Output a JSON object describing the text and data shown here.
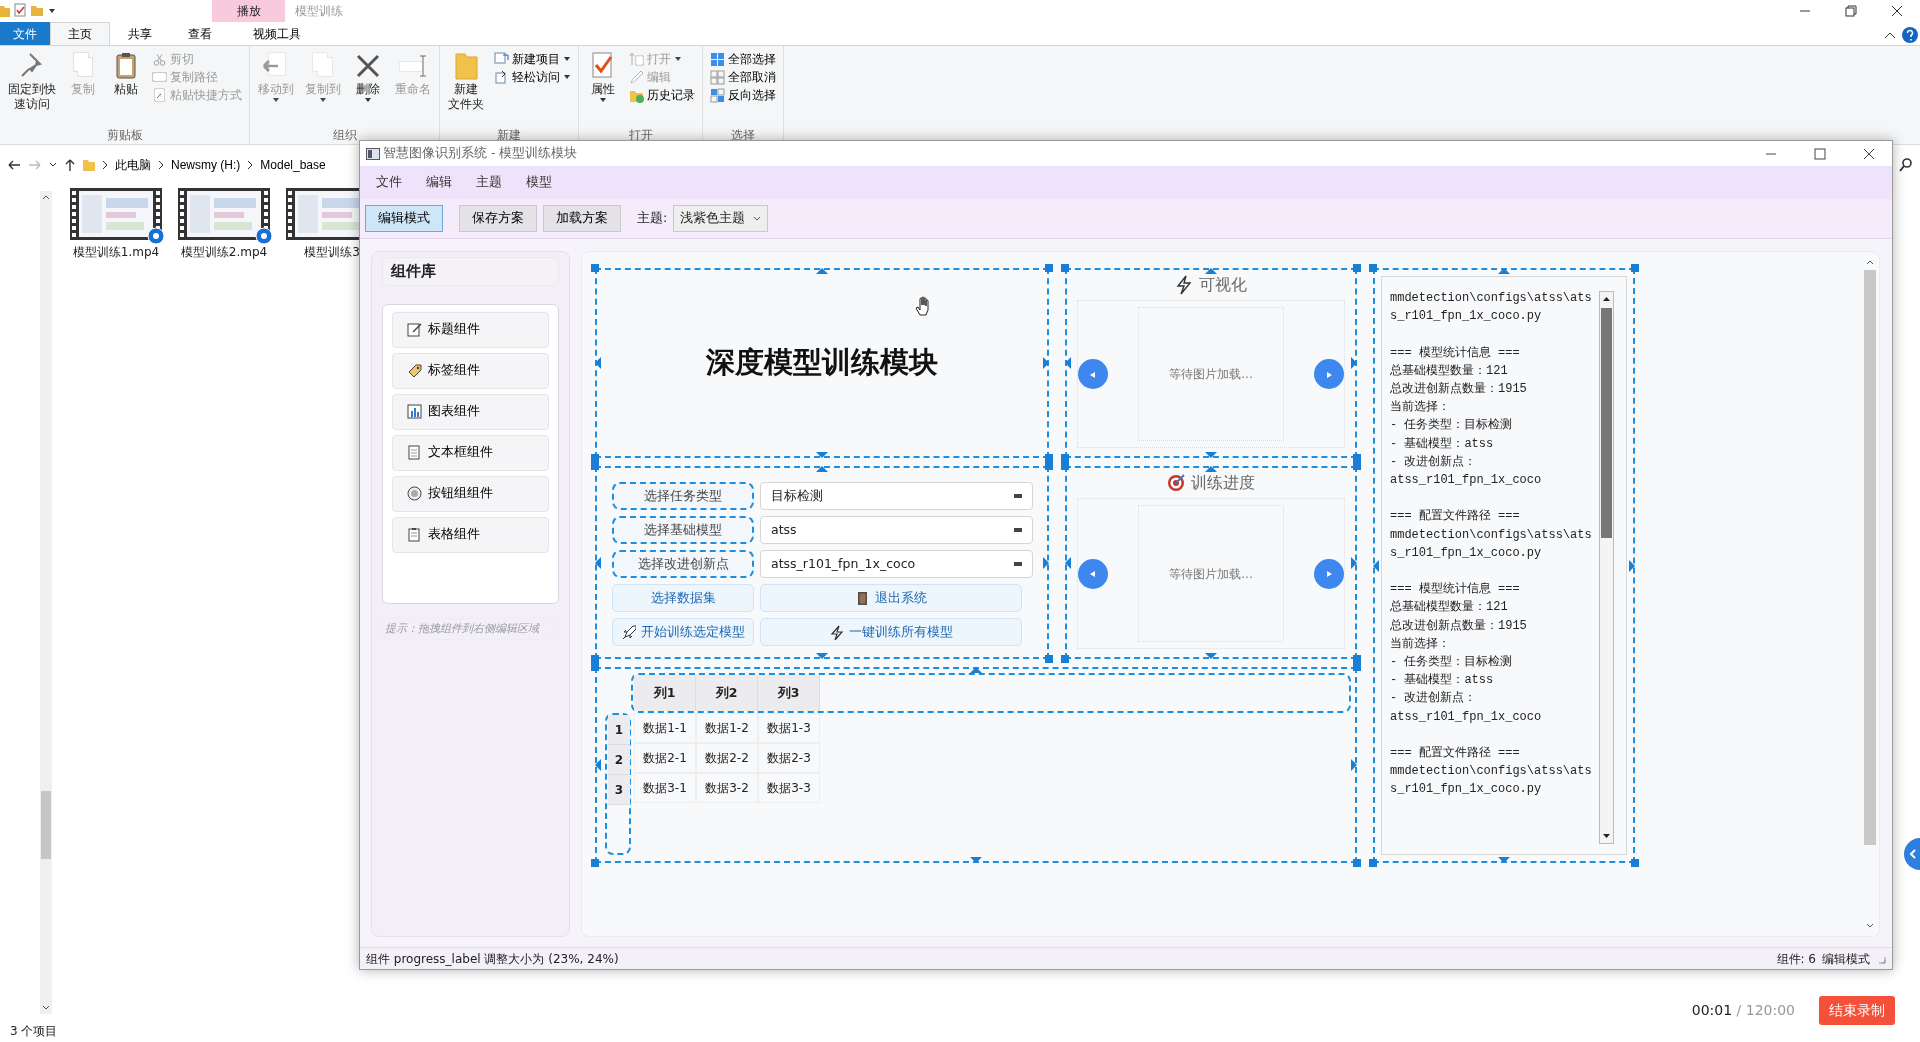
{
  "explorer": {
    "title": "模型训练",
    "context_tab": "播放",
    "tabs": [
      {
        "label": "文件",
        "kind": "file",
        "selected": false
      },
      {
        "label": "主页",
        "kind": "tab",
        "selected": true
      },
      {
        "label": "共享",
        "kind": "tab",
        "selected": false
      },
      {
        "label": "查看",
        "kind": "tab",
        "selected": false
      },
      {
        "label": "视频工具",
        "kind": "tab",
        "selected": false
      }
    ],
    "ribbon": [
      {
        "label": "剪贴板",
        "items": [
          {
            "kind": "large",
            "label": [
              "固定到快",
              "速访问"
            ],
            "disabled": false
          },
          {
            "kind": "large",
            "label": "复制",
            "disabled": true
          },
          {
            "kind": "large",
            "label": "粘贴",
            "disabled": false
          },
          {
            "kind": "small",
            "label": "剪切",
            "disabled": true
          },
          {
            "kind": "small",
            "label": "复制路径",
            "disabled": true
          },
          {
            "kind": "small",
            "label": "粘贴快捷方式",
            "disabled": true
          }
        ]
      },
      {
        "label": "组织",
        "items": [
          {
            "kind": "large",
            "label": "移动到",
            "disabled": true,
            "dropdown": true
          },
          {
            "kind": "large",
            "label": "复制到",
            "disabled": true,
            "dropdown": true
          },
          {
            "kind": "large",
            "label": "删除",
            "disabled": false,
            "dropdown": true
          },
          {
            "kind": "large",
            "label": "重命名",
            "disabled": true
          }
        ]
      },
      {
        "label": "新建",
        "items": [
          {
            "kind": "large",
            "label": [
              "新建",
              "文件夹"
            ],
            "disabled": false
          },
          {
            "kind": "small",
            "label": "新建项目",
            "disabled": false,
            "dropdown": true
          },
          {
            "kind": "small",
            "label": "轻松访问",
            "disabled": false,
            "dropdown": true
          }
        ]
      },
      {
        "label": "打开",
        "items": [
          {
            "kind": "large",
            "label": "属性",
            "disabled": false,
            "dropdown": true
          },
          {
            "kind": "small",
            "label": "打开",
            "disabled": true,
            "dropdown": true
          },
          {
            "kind": "small",
            "label": "编辑",
            "disabled": true
          },
          {
            "kind": "small",
            "label": "历史记录",
            "disabled": false
          }
        ]
      },
      {
        "label": "选择",
        "items": [
          {
            "kind": "small",
            "label": "全部选择",
            "disabled": false
          },
          {
            "kind": "small",
            "label": "全部取消",
            "disabled": false
          },
          {
            "kind": "small",
            "label": "反向选择",
            "disabled": false
          }
        ]
      }
    ],
    "breadcrumb": [
      "此电脑",
      "Newsmy (H:)",
      "Model_base"
    ],
    "files": [
      {
        "name": "模型训练1.mp4",
        "badge": true
      },
      {
        "name": "模型训练2.mp4",
        "badge": true
      },
      {
        "name": "模型训练3",
        "badge": false
      }
    ],
    "status": "3 个项目"
  },
  "recording": {
    "elapsed": "00:01",
    "total": "/ 120:00",
    "stop_button": "结束录制"
  },
  "app": {
    "title": "智慧图像识别系统 - 模型训练模块",
    "menu": [
      "文件",
      "编辑",
      "主题",
      "模型"
    ],
    "toolbar": [
      {
        "label": "编辑模式",
        "selected": true
      },
      {
        "label": "保存方案",
        "selected": false
      },
      {
        "label": "加载方案",
        "selected": false
      }
    ],
    "theme_label": "主题:",
    "theme_value": "浅紫色主题",
    "library": {
      "title": "组件库",
      "items": [
        "标题组件",
        "标签组件",
        "图表组件",
        "文本框组件",
        "按钮组组件",
        "表格组件"
      ],
      "hint": "提示：拖拽组件到右侧编辑区域"
    },
    "heading": "深度模型训练模块",
    "selectors": [
      {
        "label": "选择任务类型",
        "value": "目标检测"
      },
      {
        "label": "选择基础模型",
        "value": "atss"
      },
      {
        "label": "选择改进创新点",
        "value": "atss_r101_fpn_1x_coco"
      }
    ],
    "actions": [
      "选择数据集",
      "退出系统",
      "开始训练选定模型",
      "一键训练所有模型"
    ],
    "viewers": [
      {
        "title": "可视化",
        "message": "等待图片加载..."
      },
      {
        "title": "训练进度",
        "message": "等待图片加载..."
      }
    ],
    "table": {
      "columns": [
        "列1",
        "列2",
        "列3"
      ],
      "rows": [
        {
          "header": "1",
          "cells": [
            "数据1-1",
            "数据1-2",
            "数据1-3"
          ]
        },
        {
          "header": "2",
          "cells": [
            "数据2-1",
            "数据2-2",
            "数据2-3"
          ]
        },
        {
          "header": "3",
          "cells": [
            "数据3-1",
            "数据3-2",
            "数据3-3"
          ]
        }
      ]
    },
    "log": "mmdetection\\configs\\atss\\ats\ns_r101_fpn_1x_coco.py\n\n=== 模型统计信息 ===\n总基础模型数量：121\n总改进创新点数量：1915\n当前选择：\n- 任务类型：目标检测\n- 基础模型：atss\n- 改进创新点：\natss_r101_fpn_1x_coco\n\n=== 配置文件路径 ===\nmmdetection\\configs\\atss\\ats\ns_r101_fpn_1x_coco.py\n\n=== 模型统计信息 ===\n总基础模型数量：121\n总改进创新点数量：1915\n当前选择：\n- 任务类型：目标检测\n- 基础模型：atss\n- 改进创新点：\natss_r101_fpn_1x_coco\n\n=== 配置文件路径 ===\nmmdetection\\configs\\atss\\ats\ns_r101_fpn_1x_coco.py",
    "status": {
      "message": "组件 progress_label 调整大小为 (23%, 24%)",
      "count": "组件: 6",
      "mode": "编辑模式"
    }
  }
}
